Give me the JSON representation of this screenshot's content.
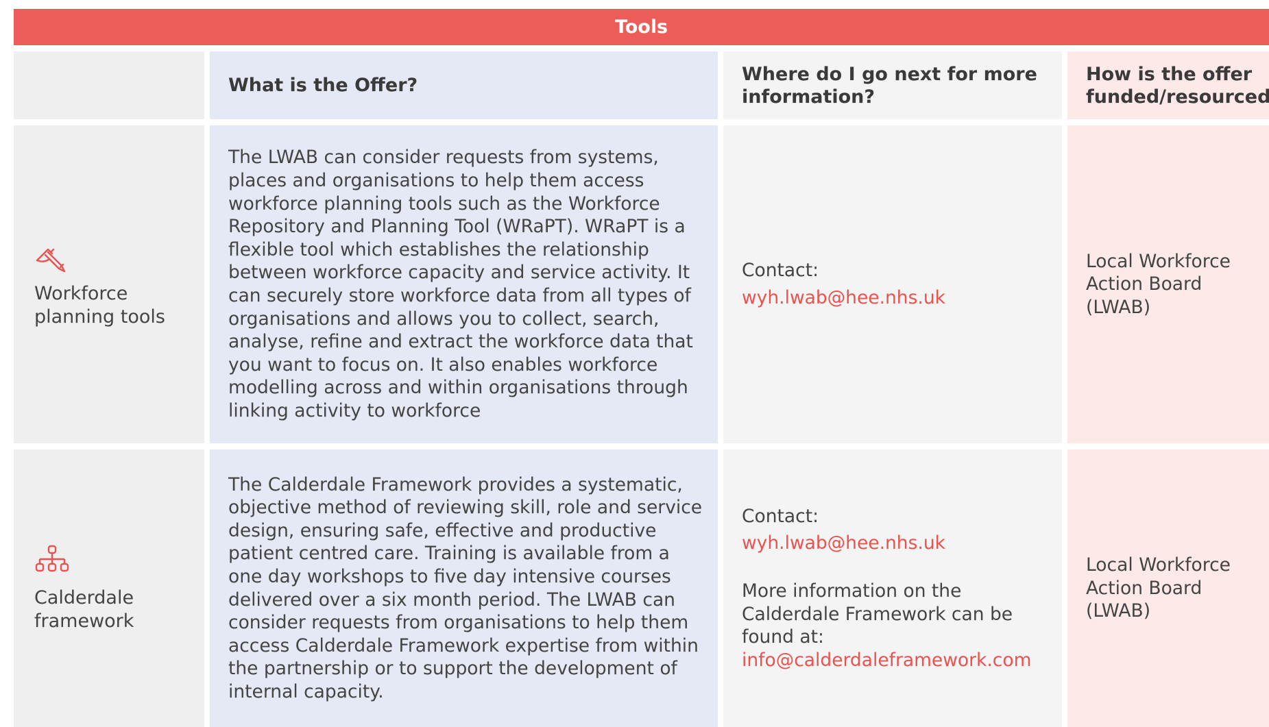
{
  "banner": {
    "title": "Tools"
  },
  "headers": {
    "offer": "What is the Offer?",
    "next_info": "Where do I go next for more information?",
    "funding": "How is the offer funded/resourced?"
  },
  "rows": [
    {
      "title": "Workforce planning tools",
      "icon": "pen-signing-icon",
      "offer": "The LWAB can consider requests from systems, places and organisations to help them access workforce planning tools such as the Workforce Repository and Planning Tool (WRaPT). WRaPT is a flexible tool which establishes the relationship between workforce capacity and service activity. It can securely store workforce data from all types of organisations and allows you to collect, search, analyse, refine and extract the workforce data that you want to focus on. It also enables workforce modelling across and within organisations through linking activity to workforce",
      "contact_label": "Contact:",
      "contact_email": "wyh.lwab@hee.nhs.uk",
      "funding": "Local Workforce Action Board (LWAB)"
    },
    {
      "title": "Calderdale framework",
      "icon": "org-chart-icon",
      "offer": "The Calderdale Framework provides a systematic, objective method of reviewing skill, role and service design, ensuring safe, effective and productive patient centred care. Training is available from a one day workshops to five day intensive courses delivered over a six month period. The LWAB can consider requests from organisations to help them access Calderdale Framework expertise from within the partnership or to support the development of internal capacity.",
      "contact_label": "Contact:",
      "contact_email": "wyh.lwab@hee.nhs.uk",
      "more_info_text": "More information on the Calderdale Framework can be found at:",
      "more_info_email": "info@calderdaleframework.com",
      "funding": "Local Workforce Action Board (LWAB)"
    }
  ],
  "colors": {
    "accent": "#ec5c58",
    "link": "#e9534f",
    "col_label_bg": "#efefef",
    "col_offer_bg": "#e5e9f5",
    "col_info_bg": "#f4f4f4",
    "col_funding_bg": "#fde9e7"
  }
}
